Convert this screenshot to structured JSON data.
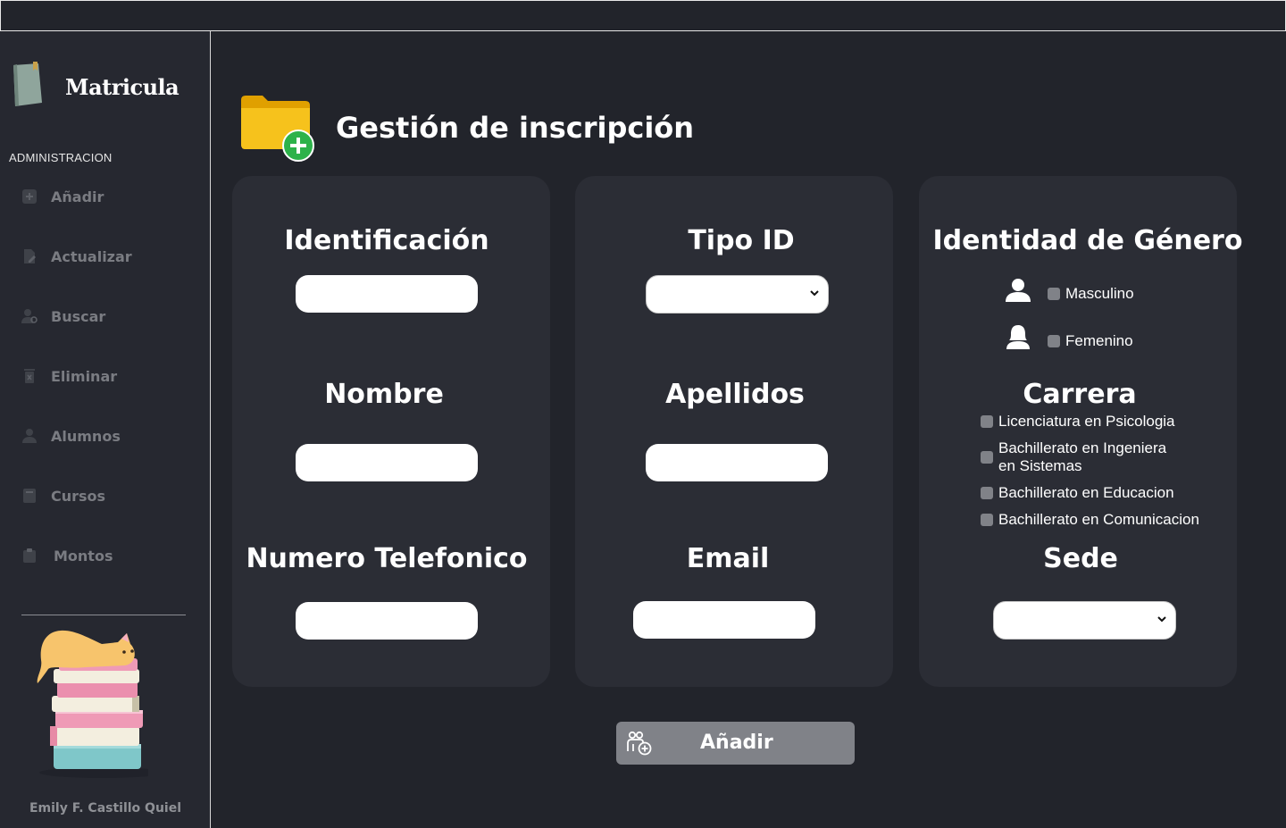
{
  "sidebar": {
    "brand": "Matricula",
    "section": "ADMINISTRACION",
    "items": [
      {
        "label": "Añadir",
        "icon": "add-icon"
      },
      {
        "label": "Actualizar",
        "icon": "edit-file-icon"
      },
      {
        "label": "Buscar",
        "icon": "user-search-icon"
      },
      {
        "label": "Eliminar",
        "icon": "delete-icon"
      },
      {
        "label": "Alumnos",
        "icon": "user-icon"
      },
      {
        "label": "Cursos",
        "icon": "book-icon"
      },
      {
        "label": "Montos",
        "icon": "clipboard-icon"
      }
    ],
    "author": "Emily F. Castillo Quiel"
  },
  "page": {
    "title": "Gestión de inscripción",
    "icon": "folder-add-icon"
  },
  "form": {
    "identificacion": {
      "label": "Identificación",
      "value": ""
    },
    "tipo_id": {
      "label": "Tipo ID",
      "selected": ""
    },
    "genero": {
      "label": "Identidad de Género",
      "options": [
        {
          "label": "Masculino",
          "icon": "male-icon"
        },
        {
          "label": "Femenino",
          "icon": "female-icon"
        }
      ]
    },
    "nombre": {
      "label": "Nombre",
      "value": ""
    },
    "apellidos": {
      "label": "Apellidos",
      "value": ""
    },
    "carrera": {
      "label": "Carrera",
      "options": [
        {
          "label": "Licenciatura en Psicologia"
        },
        {
          "label": "Bachillerato en Ingeniera",
          "label2": "en Sistemas"
        },
        {
          "label": "Bachillerato en Educacion"
        },
        {
          "label": "Bachillerato en Comunicacion"
        }
      ]
    },
    "telefono": {
      "label": "Numero Telefonico",
      "value": ""
    },
    "email": {
      "label": "Email",
      "value": ""
    },
    "sede": {
      "label": "Sede",
      "selected": ""
    }
  },
  "add_button": {
    "label": "Añadir",
    "icon": "add-group-icon"
  },
  "colors": {
    "background": "#22242b",
    "sidebar": "#262830",
    "card": "#2b2d35",
    "button": "#808288",
    "checkbox": "#808288",
    "folder": "#f5b800",
    "folder_plus": "#2db24a"
  }
}
